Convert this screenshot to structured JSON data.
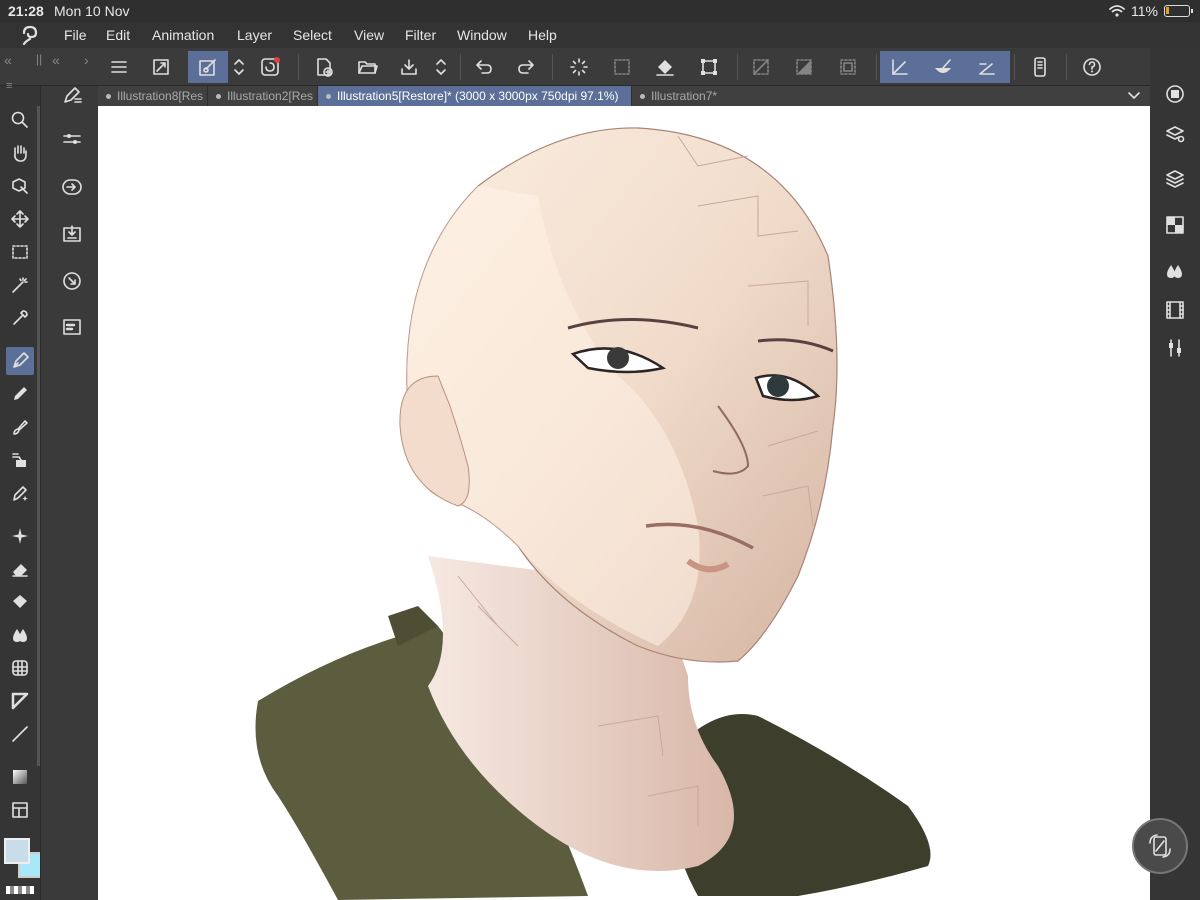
{
  "status": {
    "time": "21:28",
    "date": "Mon 10 Nov",
    "battery": "11%",
    "battery_level": 0.11
  },
  "menu": [
    "File",
    "Edit",
    "Animation",
    "Layer",
    "Select",
    "View",
    "Filter",
    "Window",
    "Help"
  ],
  "command_icons": [
    "menu-icon",
    "fit-icon",
    "pen-sync-icon",
    "updown-icon",
    "record-icon",
    "new-icon",
    "open-icon",
    "save-icon",
    "updown-icon",
    "undo-icon",
    "redo-icon",
    "loading-icon",
    "select-dots-icon",
    "fill-icon",
    "transform-icon",
    "clear-out-icon",
    "fill-in-icon",
    "crop-icon",
    "snap-ruler-icon",
    "snap-special-icon",
    "snap-grid-icon",
    "companion-icon",
    "help-icon"
  ],
  "tabs": [
    {
      "label": "Illustration8[Res",
      "active": false
    },
    {
      "label": "Illustration2[Res",
      "active": false
    },
    {
      "label": "Illustration5[Restore]* (3000 x 3000px 750dpi 97.1%)",
      "active": true
    },
    {
      "label": "Illustration7*",
      "active": false
    }
  ],
  "tools": [
    "zoom-icon",
    "hand-icon",
    "object-icon",
    "move-icon",
    "selection-icon",
    "wand-icon",
    "eyedropper-icon",
    "pen-icon",
    "pencil-icon",
    "brush-icon",
    "airbrush-icon",
    "decoration-icon",
    "sparkle-icon",
    "eraser-icon",
    "fill-icon",
    "blend-icon",
    "figure-icon",
    "frame-icon",
    "line-icon",
    "gradient-icon",
    "border-icon"
  ],
  "sub_tools": [
    "sub-tool-icon",
    "tool-property-icon",
    "brush-size-icon",
    "import-icon",
    "navigator-icon",
    "layer-property-icon"
  ],
  "right_tools": [
    "color-wheel-icon",
    "layer-search-icon",
    "layers-icon",
    "material-icon",
    "color-mix-icon",
    "timeline-icon",
    "adjust-icon"
  ],
  "colors": {
    "accent": "#5b6f98",
    "main_color": "#c8dcea",
    "sub_color": "#a8e8f8"
  }
}
